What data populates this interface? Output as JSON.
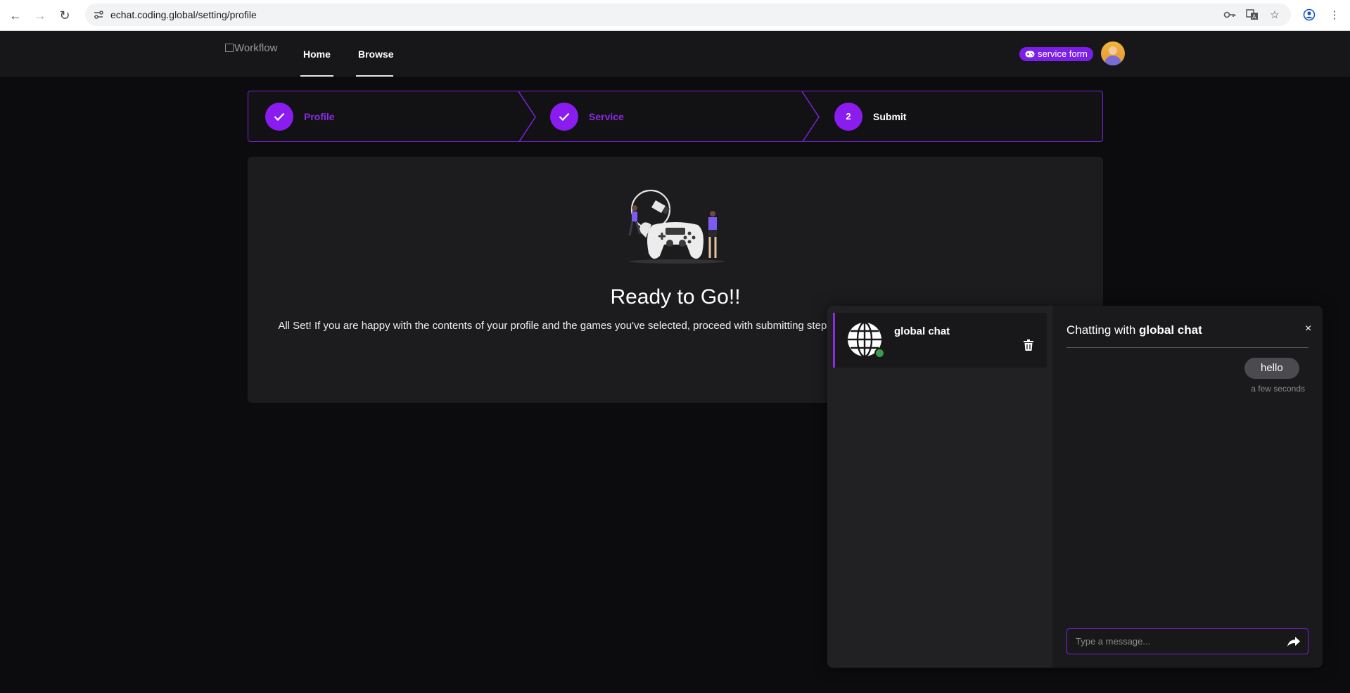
{
  "browser": {
    "url": "echat.coding.global/setting/profile",
    "back_icon": "arrow-left",
    "forward_icon": "arrow-right",
    "reload_icon": "reload",
    "right_icons": [
      "key-icon",
      "translate-icon",
      "star-icon",
      "profile-icon",
      "menu-dots-icon"
    ]
  },
  "nav": {
    "logo_alt": "Workflow",
    "links": [
      {
        "label": "Home"
      },
      {
        "label": "Browse"
      }
    ],
    "service_pill": "service form",
    "accent": "#7b1fe8"
  },
  "stepper": {
    "steps": [
      {
        "label": "Profile",
        "status": "complete"
      },
      {
        "label": "Service",
        "status": "complete"
      },
      {
        "label": "Submit",
        "status": "current",
        "number": "2"
      }
    ]
  },
  "main": {
    "title": "Ready to Go!!",
    "description": "All Set! If you are happy with the contents of your profile and the games you've selected, proceed with submitting steps. If you have any questions, please contact support."
  },
  "chat": {
    "conversations": [
      {
        "name": "global chat",
        "online": true
      }
    ],
    "header_prefix": "Chatting with",
    "header_name": "global chat",
    "close_label": "×",
    "messages": [
      {
        "text": "hello",
        "time": "a few seconds"
      }
    ],
    "input_placeholder": "Type a message..."
  }
}
